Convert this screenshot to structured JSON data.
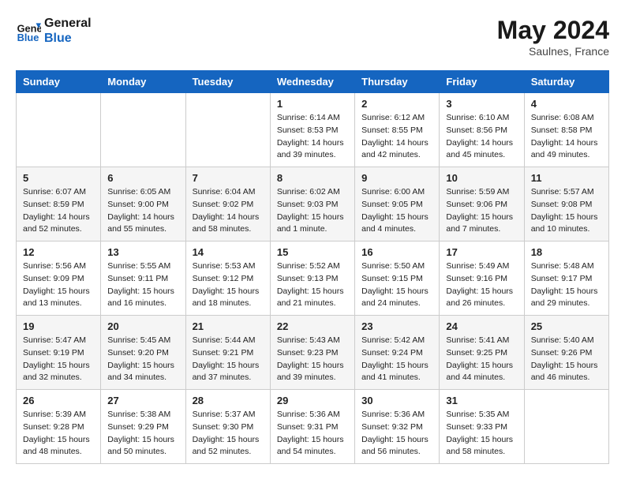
{
  "header": {
    "logo_line1": "General",
    "logo_line2": "Blue",
    "month": "May 2024",
    "location": "Saulnes, France"
  },
  "weekdays": [
    "Sunday",
    "Monday",
    "Tuesday",
    "Wednesday",
    "Thursday",
    "Friday",
    "Saturday"
  ],
  "weeks": [
    [
      {
        "day": "",
        "sunrise": "",
        "sunset": "",
        "daylight": ""
      },
      {
        "day": "",
        "sunrise": "",
        "sunset": "",
        "daylight": ""
      },
      {
        "day": "",
        "sunrise": "",
        "sunset": "",
        "daylight": ""
      },
      {
        "day": "1",
        "sunrise": "Sunrise: 6:14 AM",
        "sunset": "Sunset: 8:53 PM",
        "daylight": "Daylight: 14 hours and 39 minutes."
      },
      {
        "day": "2",
        "sunrise": "Sunrise: 6:12 AM",
        "sunset": "Sunset: 8:55 PM",
        "daylight": "Daylight: 14 hours and 42 minutes."
      },
      {
        "day": "3",
        "sunrise": "Sunrise: 6:10 AM",
        "sunset": "Sunset: 8:56 PM",
        "daylight": "Daylight: 14 hours and 45 minutes."
      },
      {
        "day": "4",
        "sunrise": "Sunrise: 6:08 AM",
        "sunset": "Sunset: 8:58 PM",
        "daylight": "Daylight: 14 hours and 49 minutes."
      }
    ],
    [
      {
        "day": "5",
        "sunrise": "Sunrise: 6:07 AM",
        "sunset": "Sunset: 8:59 PM",
        "daylight": "Daylight: 14 hours and 52 minutes."
      },
      {
        "day": "6",
        "sunrise": "Sunrise: 6:05 AM",
        "sunset": "Sunset: 9:00 PM",
        "daylight": "Daylight: 14 hours and 55 minutes."
      },
      {
        "day": "7",
        "sunrise": "Sunrise: 6:04 AM",
        "sunset": "Sunset: 9:02 PM",
        "daylight": "Daylight: 14 hours and 58 minutes."
      },
      {
        "day": "8",
        "sunrise": "Sunrise: 6:02 AM",
        "sunset": "Sunset: 9:03 PM",
        "daylight": "Daylight: 15 hours and 1 minute."
      },
      {
        "day": "9",
        "sunrise": "Sunrise: 6:00 AM",
        "sunset": "Sunset: 9:05 PM",
        "daylight": "Daylight: 15 hours and 4 minutes."
      },
      {
        "day": "10",
        "sunrise": "Sunrise: 5:59 AM",
        "sunset": "Sunset: 9:06 PM",
        "daylight": "Daylight: 15 hours and 7 minutes."
      },
      {
        "day": "11",
        "sunrise": "Sunrise: 5:57 AM",
        "sunset": "Sunset: 9:08 PM",
        "daylight": "Daylight: 15 hours and 10 minutes."
      }
    ],
    [
      {
        "day": "12",
        "sunrise": "Sunrise: 5:56 AM",
        "sunset": "Sunset: 9:09 PM",
        "daylight": "Daylight: 15 hours and 13 minutes."
      },
      {
        "day": "13",
        "sunrise": "Sunrise: 5:55 AM",
        "sunset": "Sunset: 9:11 PM",
        "daylight": "Daylight: 15 hours and 16 minutes."
      },
      {
        "day": "14",
        "sunrise": "Sunrise: 5:53 AM",
        "sunset": "Sunset: 9:12 PM",
        "daylight": "Daylight: 15 hours and 18 minutes."
      },
      {
        "day": "15",
        "sunrise": "Sunrise: 5:52 AM",
        "sunset": "Sunset: 9:13 PM",
        "daylight": "Daylight: 15 hours and 21 minutes."
      },
      {
        "day": "16",
        "sunrise": "Sunrise: 5:50 AM",
        "sunset": "Sunset: 9:15 PM",
        "daylight": "Daylight: 15 hours and 24 minutes."
      },
      {
        "day": "17",
        "sunrise": "Sunrise: 5:49 AM",
        "sunset": "Sunset: 9:16 PM",
        "daylight": "Daylight: 15 hours and 26 minutes."
      },
      {
        "day": "18",
        "sunrise": "Sunrise: 5:48 AM",
        "sunset": "Sunset: 9:17 PM",
        "daylight": "Daylight: 15 hours and 29 minutes."
      }
    ],
    [
      {
        "day": "19",
        "sunrise": "Sunrise: 5:47 AM",
        "sunset": "Sunset: 9:19 PM",
        "daylight": "Daylight: 15 hours and 32 minutes."
      },
      {
        "day": "20",
        "sunrise": "Sunrise: 5:45 AM",
        "sunset": "Sunset: 9:20 PM",
        "daylight": "Daylight: 15 hours and 34 minutes."
      },
      {
        "day": "21",
        "sunrise": "Sunrise: 5:44 AM",
        "sunset": "Sunset: 9:21 PM",
        "daylight": "Daylight: 15 hours and 37 minutes."
      },
      {
        "day": "22",
        "sunrise": "Sunrise: 5:43 AM",
        "sunset": "Sunset: 9:23 PM",
        "daylight": "Daylight: 15 hours and 39 minutes."
      },
      {
        "day": "23",
        "sunrise": "Sunrise: 5:42 AM",
        "sunset": "Sunset: 9:24 PM",
        "daylight": "Daylight: 15 hours and 41 minutes."
      },
      {
        "day": "24",
        "sunrise": "Sunrise: 5:41 AM",
        "sunset": "Sunset: 9:25 PM",
        "daylight": "Daylight: 15 hours and 44 minutes."
      },
      {
        "day": "25",
        "sunrise": "Sunrise: 5:40 AM",
        "sunset": "Sunset: 9:26 PM",
        "daylight": "Daylight: 15 hours and 46 minutes."
      }
    ],
    [
      {
        "day": "26",
        "sunrise": "Sunrise: 5:39 AM",
        "sunset": "Sunset: 9:28 PM",
        "daylight": "Daylight: 15 hours and 48 minutes."
      },
      {
        "day": "27",
        "sunrise": "Sunrise: 5:38 AM",
        "sunset": "Sunset: 9:29 PM",
        "daylight": "Daylight: 15 hours and 50 minutes."
      },
      {
        "day": "28",
        "sunrise": "Sunrise: 5:37 AM",
        "sunset": "Sunset: 9:30 PM",
        "daylight": "Daylight: 15 hours and 52 minutes."
      },
      {
        "day": "29",
        "sunrise": "Sunrise: 5:36 AM",
        "sunset": "Sunset: 9:31 PM",
        "daylight": "Daylight: 15 hours and 54 minutes."
      },
      {
        "day": "30",
        "sunrise": "Sunrise: 5:36 AM",
        "sunset": "Sunset: 9:32 PM",
        "daylight": "Daylight: 15 hours and 56 minutes."
      },
      {
        "day": "31",
        "sunrise": "Sunrise: 5:35 AM",
        "sunset": "Sunset: 9:33 PM",
        "daylight": "Daylight: 15 hours and 58 minutes."
      },
      {
        "day": "",
        "sunrise": "",
        "sunset": "",
        "daylight": ""
      }
    ]
  ]
}
